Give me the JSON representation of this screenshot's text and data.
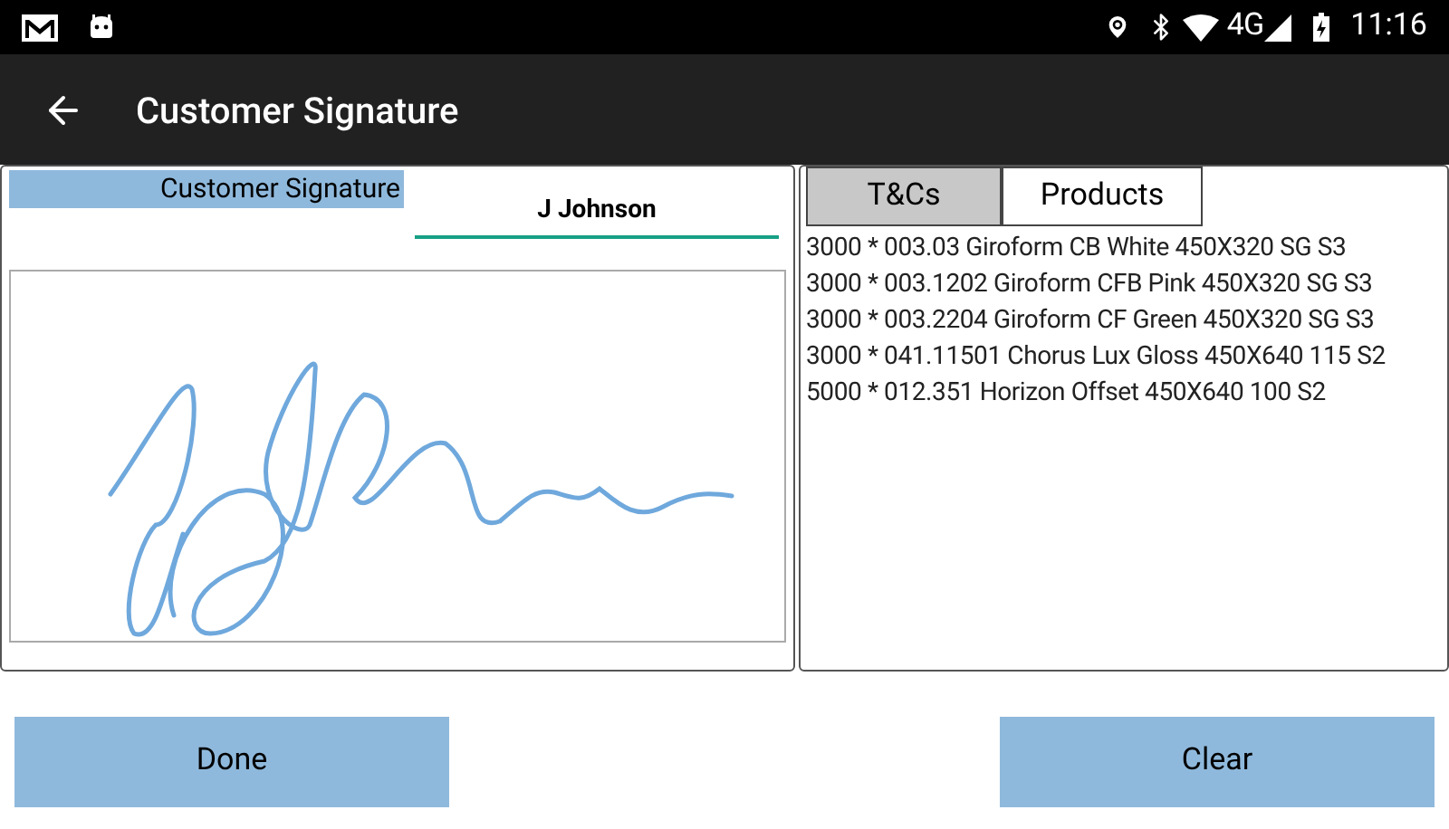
{
  "status_bar": {
    "time": "11:16",
    "network": "4G"
  },
  "app_bar": {
    "title": "Customer Signature"
  },
  "signature_panel": {
    "label": "Customer Signature",
    "signer": {
      "value": "J Johnson"
    }
  },
  "tabs": [
    {
      "label": "T&Cs",
      "selected": true
    },
    {
      "label": "Products",
      "selected": false
    }
  ],
  "products": [
    "3000 * 003.03 Giroform CB White 450X320 SG S3",
    "3000 * 003.1202 Giroform CFB Pink 450X320 SG S3",
    "3000 * 003.2204 Giroform CF Green 450X320 SG S3",
    "3000 * 041.11501 Chorus Lux Gloss 450X640 115 S2",
    "5000 * 012.351 Horizon Offset 450X640 100 S2"
  ],
  "buttons": [
    "Done",
    "Clear"
  ]
}
